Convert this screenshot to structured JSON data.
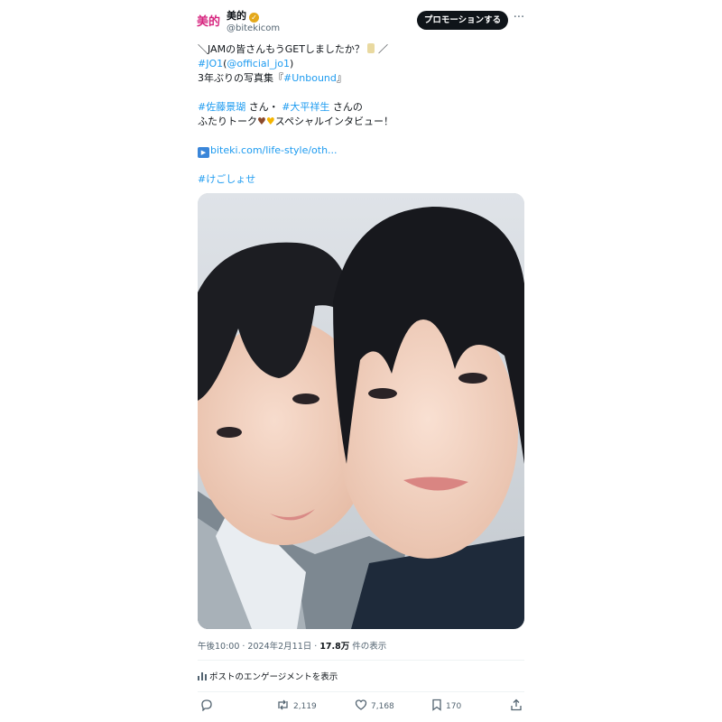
{
  "account": {
    "avatar_text": "美的",
    "name": "美的",
    "verified_mark": "✓",
    "handle": "@bitekicom"
  },
  "header": {
    "promote_label": "プロモーションする",
    "more_glyph": "···"
  },
  "tweet": {
    "line1_text": "＼JAMの皆さんもうGETしましたか？",
    "line1_end": "／",
    "line2_tag": "#JO1",
    "line2_open": "(",
    "line2_mention": "@official_jo1",
    "line2_close": ")",
    "line3_text": "3年ぶりの写真集『",
    "line3_tag": "#Unbound",
    "line3_end": "』",
    "line4_tag1": "#佐藤景瑚",
    "line4_mid": " さん・ ",
    "line4_tag2": "#大平祥生",
    "line4_end": " さんの",
    "line5_text_a": "ふたりトーク",
    "line5_heart1": "♥",
    "line5_heart2": "♥",
    "line5_text_b": "スペシャルインタビュー！",
    "link_icon": "▶",
    "link_text": "biteki.com/life-style/oth...",
    "hashtag_last": "#けごしょせ"
  },
  "photo": {
    "alt": "Two young men posing cheek to cheek"
  },
  "meta": {
    "time_date": "午後10:00 · 2024年2月11日 · ",
    "views": "17.8万",
    "views_suffix": " 件の表示"
  },
  "engagement": {
    "label": "ポストのエンゲージメントを表示"
  },
  "actions": {
    "reply_count": "",
    "repost_count": "2,119",
    "like_count": "7,168",
    "bookmark_count": "170"
  },
  "colors": {
    "link": "#1d9bf0",
    "brand": "#d6257f",
    "text": "#0f1419",
    "muted": "#536471"
  }
}
